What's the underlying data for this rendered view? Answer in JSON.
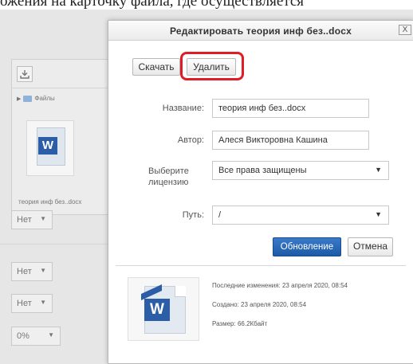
{
  "background_text": "ожения на карточку файла, где осуществляется",
  "sidebar": {
    "breadcrumb": "Файлы",
    "file_name": "теория инф без..docx",
    "selects": [
      "Нет",
      "Нет",
      "Нет",
      "0%"
    ]
  },
  "dialog": {
    "title": "Редактировать теория инф без..docx",
    "close": "X",
    "download_label": "Скачать",
    "delete_label": "Удалить",
    "fields": {
      "name_label": "Название:",
      "name_value": "теория инф без..docx",
      "author_label": "Автор:",
      "author_value": "Алеся Викторовна Кашина",
      "license_label": "Выберите лицензию",
      "license_value": "Все права защищены",
      "path_label": "Путь:",
      "path_value": "/"
    },
    "update_label": "Обновление",
    "cancel_label": "Отмена",
    "info": {
      "modified": "Последние изменения:  23 апреля 2020, 08:54",
      "created": "Создано:  23 апреля 2020, 08:54",
      "size": "Размер:  66.2Кбайт"
    }
  },
  "colors": {
    "accent": "#1c5aa6",
    "highlight": "#e01c27",
    "word_icon": "#2b5ea7"
  }
}
